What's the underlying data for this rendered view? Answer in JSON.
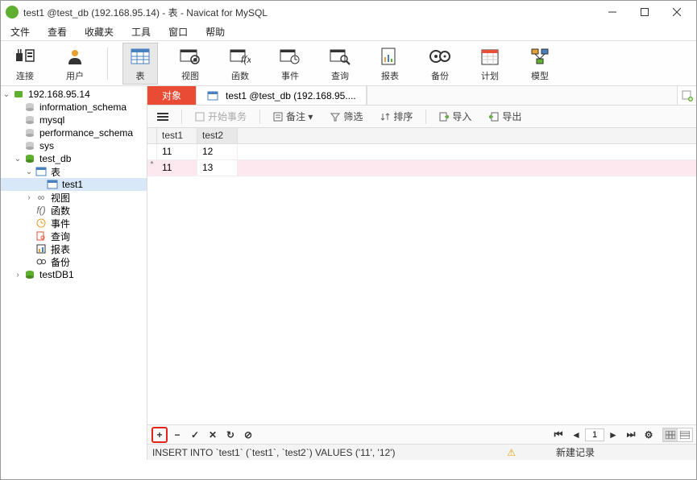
{
  "titlebar": {
    "text": "test1 @test_db (192.168.95.14) - 表 - Navicat for MySQL"
  },
  "menubar": {
    "file": "文件",
    "view": "查看",
    "favorite": "收藏夹",
    "tools": "工具",
    "window": "窗口",
    "help": "帮助"
  },
  "toolbar": {
    "connect": "连接",
    "user": "用户",
    "table": "表",
    "view": "视图",
    "func": "函数",
    "event": "事件",
    "query": "查询",
    "report": "报表",
    "backup": "备份",
    "schedule": "计划",
    "model": "模型"
  },
  "sidebar": {
    "server": "192.168.95.14",
    "info_schema": "information_schema",
    "mysql": "mysql",
    "perf_schema": "performance_schema",
    "sys": "sys",
    "test_db": "test_db",
    "tables": "表",
    "test1": "test1",
    "views": "视图",
    "funcs": "函数",
    "events": "事件",
    "queries": "查询",
    "reports": "报表",
    "backups": "备份",
    "testDB1": "testDB1"
  },
  "tabs": {
    "objects": "对象",
    "tab1": "test1 @test_db (192.168.95...."
  },
  "subtoolbar": {
    "begin_tx": "开始事务",
    "memo": "备注 ▾",
    "filter": "筛选",
    "sort": "排序",
    "import": "导入",
    "export": "导出"
  },
  "grid": {
    "columns": [
      "test1",
      "test2"
    ],
    "rows": [
      {
        "gutter": "",
        "c0": "11",
        "c1": "12"
      },
      {
        "gutter": "*",
        "c0": "11",
        "c1": "13",
        "new": true
      }
    ]
  },
  "editbar": {
    "page": "1"
  },
  "statusbar": {
    "sql": "INSERT INTO `test1` (`test1`, `test2`) VALUES ('11', '12')",
    "mode": "新建记录"
  }
}
